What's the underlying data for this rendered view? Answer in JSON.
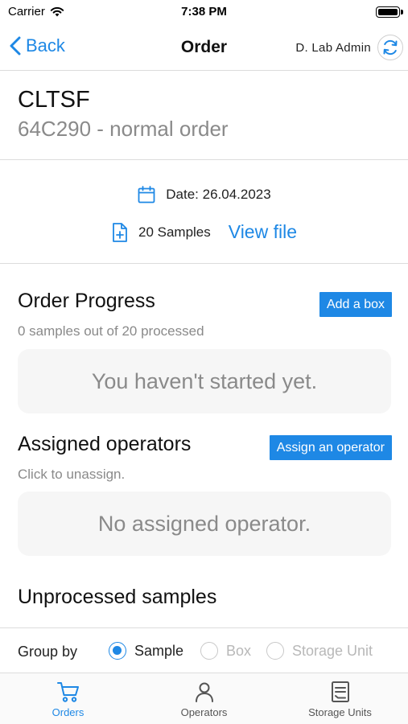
{
  "status_bar": {
    "carrier": "Carrier",
    "time": "7:38 PM"
  },
  "nav": {
    "back_label": "Back",
    "title": "Order",
    "user_name": "D. Lab Admin"
  },
  "order": {
    "code": "CLTSF",
    "subtitle": "64C290 - normal order"
  },
  "meta": {
    "date": "Date: 26.04.2023",
    "samples": "20 Samples",
    "view_file": "View file"
  },
  "progress": {
    "title": "Order Progress",
    "subtitle": "0 samples out of 20 processed",
    "button": "Add a box",
    "empty": "You haven't started yet."
  },
  "operators": {
    "title": "Assigned operators",
    "subtitle": "Click to unassign.",
    "button": "Assign an operator",
    "empty": "No assigned operator."
  },
  "unprocessed": {
    "title": "Unprocessed samples"
  },
  "group_by": {
    "label": "Group by",
    "options": [
      {
        "label": "Sample",
        "selected": true
      },
      {
        "label": "Box",
        "selected": false
      },
      {
        "label": "Storage Unit",
        "selected": false
      }
    ]
  },
  "tabs": [
    {
      "label": "Orders",
      "icon": "cart-icon",
      "active": true
    },
    {
      "label": "Operators",
      "icon": "person-icon",
      "active": false
    },
    {
      "label": "Storage Units",
      "icon": "storage-icon",
      "active": false
    }
  ],
  "colors": {
    "accent": "#1e88e5",
    "muted_text": "#8a8a8a",
    "placeholder_bg": "#f6f6f6"
  }
}
